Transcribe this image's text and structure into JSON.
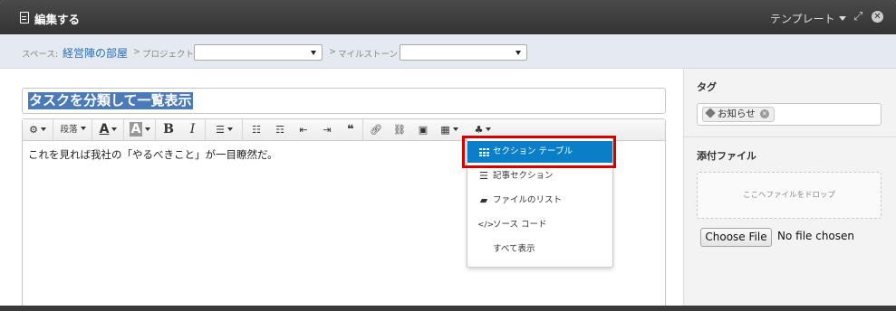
{
  "titlebar": {
    "title": "編集する",
    "template_label": "テンプレート"
  },
  "breadcrumb": {
    "space_label": "スペース:",
    "space_name": "経営陣の部屋",
    "arrow": ">",
    "project_label": "プロジェクト",
    "project_value": "",
    "milestone_label": "マイルストーン",
    "milestone_value": ""
  },
  "editor": {
    "title_value": "タスクを分類して一覧表示",
    "body_text": "これを見れば我社の「やるべきこと」が一目瞭然だ。",
    "toolbar": {
      "paragraph_label": "段落",
      "font_color_label": "A",
      "bg_color_label": "A",
      "bold_label": "B",
      "italic_label": "I",
      "quote_label": "❝"
    }
  },
  "insert_menu": {
    "items": [
      {
        "label": "セクション テーブル",
        "icon": "grid-icon"
      },
      {
        "label": "記事セクション",
        "icon": "list-icon"
      },
      {
        "label": "ファイルのリスト",
        "icon": "folder-icon"
      },
      {
        "label": "ソース コード",
        "icon": "code-icon"
      },
      {
        "label": "すべて表示",
        "icon": ""
      }
    ],
    "active_index": 0,
    "active_color": "#0a7ec7",
    "highlight_color": "#d40000"
  },
  "sidebar": {
    "tag_heading": "タグ",
    "tags": [
      "お知らせ"
    ],
    "attach_heading": "添付ファイル",
    "dropzone_text": "ここへファイルをドロップ",
    "choose_file_label": "Choose File",
    "no_file_label": "No file chosen"
  }
}
